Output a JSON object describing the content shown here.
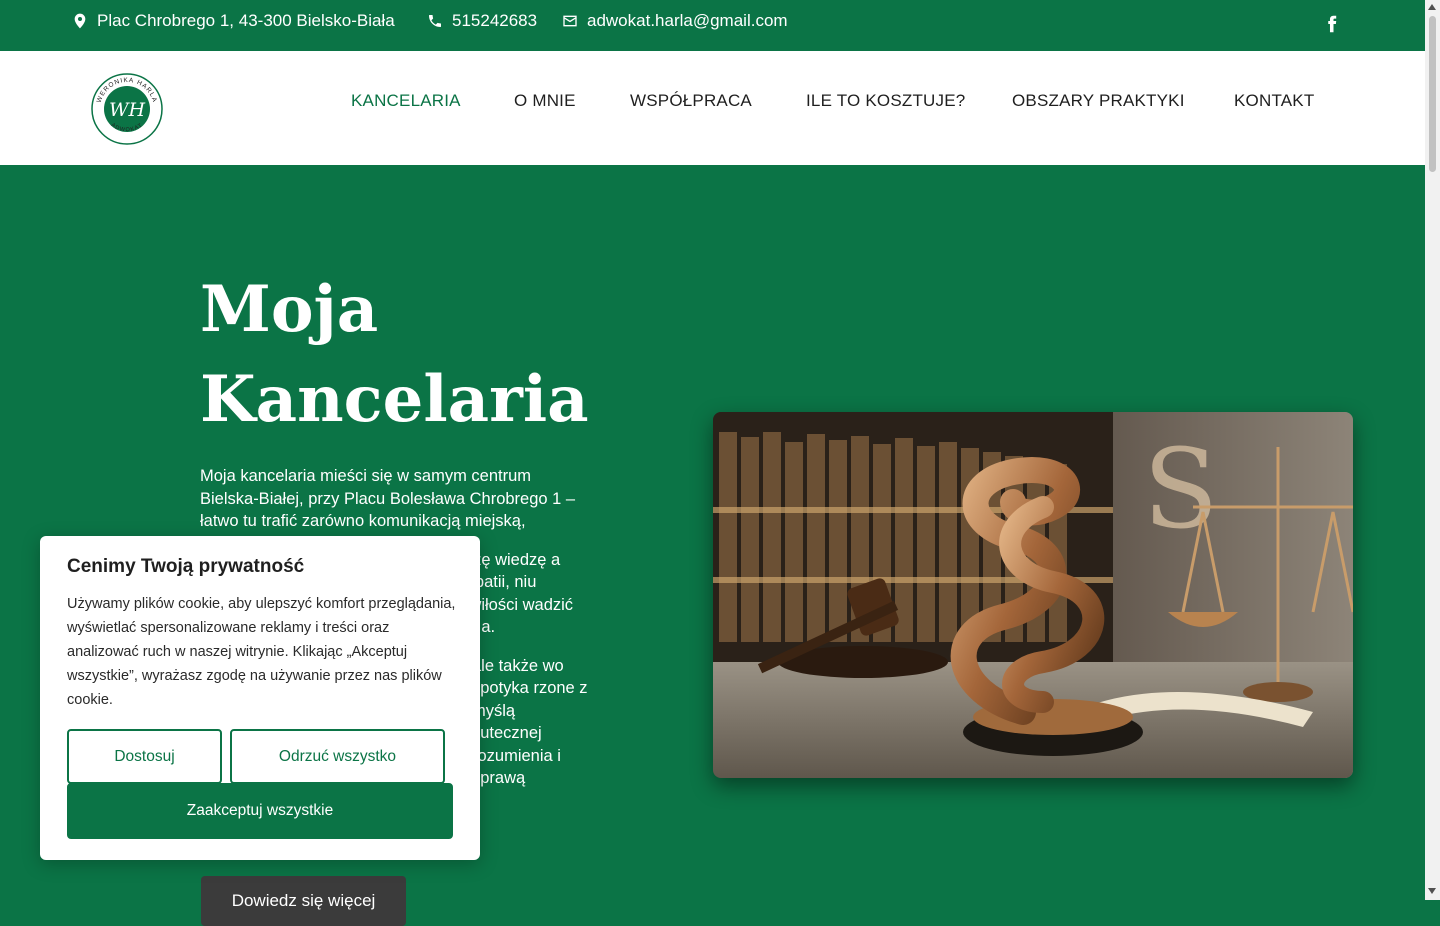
{
  "topbar": {
    "address": "Plac Chrobrego 1, 43-300 Bielsko-Biała",
    "phone": "515242683",
    "email": "adwokat.harla@gmail.com",
    "facebook_icon": "facebook-icon"
  },
  "logo": {
    "monogram": "WH",
    "name_top": "WERONIKA HARLA",
    "name_bottom": "ADWOKAT"
  },
  "nav": {
    "items": [
      {
        "label": "KANCELARIA",
        "active": true
      },
      {
        "label": "O MNIE"
      },
      {
        "label": "WSPÓŁPRACA"
      },
      {
        "label": "ILE TO KOSZTUJE?"
      },
      {
        "label": "OBSZARY PRAKTYKI"
      },
      {
        "label": "KONTAKT"
      }
    ]
  },
  "hero": {
    "title_line1": "Moja",
    "title_line2": "Kancelaria",
    "paragraphs": [
      "Moja kancelaria mieści się w samym centrum Bielska-Białej, przy Placu Bolesława Chrobrego 1 – łatwo tu trafić zarówno komunikacją miejską,",
      "łączę wiedzę a empatii, niu zawiłości wadzić Cię a.",
      "ale także wo spotyka rzone z myślą kutecznej rozumienia i sprawą"
    ],
    "button_label": "Dowiedz się więcej"
  },
  "cookie": {
    "title": "Cenimy Twoją prywatność",
    "body": "Używamy plików cookie, aby ulepszyć komfort przeglądania, wyświetlać spersonalizowane reklamy i treści oraz analizować ruch w naszej witrynie. Klikając „Akceptuj wszystkie”, wyrażasz zgodę na używanie przez nas plików cookie.",
    "customize_label": "Dostosuj",
    "reject_label": "Odrzuć wszystko",
    "accept_label": "Zaakceptuj wszystkie"
  },
  "colors": {
    "brand_green": "#0b7446",
    "dark_button": "#3b3b3b"
  }
}
